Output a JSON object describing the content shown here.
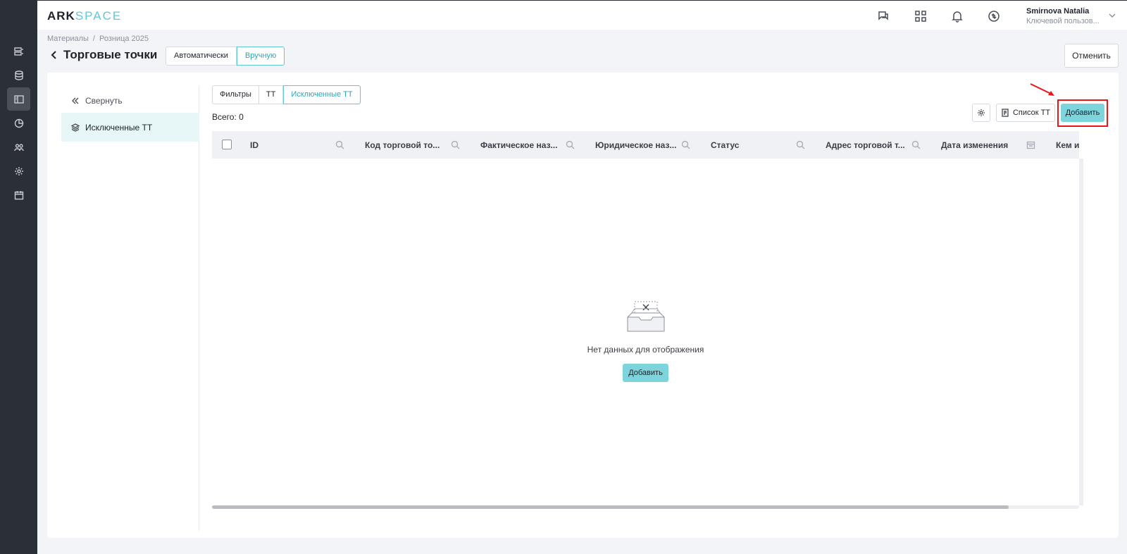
{
  "app": {
    "logo_ark": "ARK",
    "logo_space": "SPACE"
  },
  "header": {
    "icons": [
      "support-chat-icon",
      "apps-grid-icon",
      "bell-icon",
      "sync-icon"
    ],
    "user_name": "Smirnova Natalia",
    "user_role": "Ключевой пользов..."
  },
  "breadcrumb": {
    "items": [
      "Материалы",
      "Розница 2025"
    ],
    "separator": "/"
  },
  "page": {
    "title": "Торговые точки",
    "mode_auto": "Автоматически",
    "mode_manual": "Вручную",
    "cancel_label": "Отменить"
  },
  "side_panel": {
    "collapse_label": "Свернуть",
    "active_item": "Исключенные ТТ"
  },
  "tabs": [
    "Фильтры",
    "ТТ",
    "Исключенные ТТ"
  ],
  "total_label": "Всего: 0",
  "toolbar": {
    "list_label": "Список ТТ",
    "add_label": "Добавить"
  },
  "table": {
    "columns": [
      "ID",
      "Код торговой то...",
      "Фактическое наз...",
      "Юридическое наз...",
      "Статус",
      "Адрес торговой т...",
      "Дата изменения",
      "Кем из"
    ]
  },
  "empty_state": {
    "text": "Нет данных для отображения",
    "button_label": "Добавить"
  },
  "colors": {
    "accent": "#5fc8d3",
    "button_fill": "#7ed4db",
    "rail": "#2b2f36",
    "annotation": "#e8161b"
  }
}
